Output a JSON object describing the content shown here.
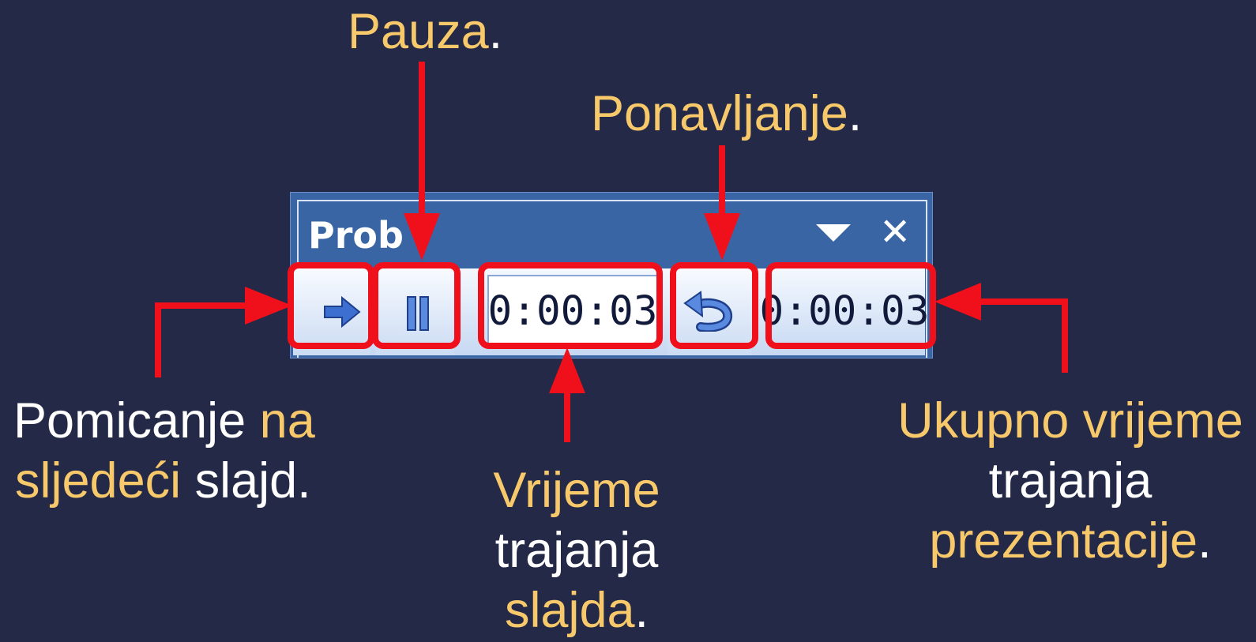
{
  "annotations": {
    "pause": {
      "main": "Pauza",
      "end": "."
    },
    "repeat": {
      "main": "Ponavljanje",
      "end": "."
    },
    "next": {
      "w1": "Pomicanje ",
      "y1": "na",
      "y2": "sljedeći",
      "w2": " slajd."
    },
    "slide_time": {
      "l1": "Vrijeme",
      "l2": "trajanja",
      "l3": "slajda",
      "end": "."
    },
    "total_time": {
      "l1": "Ukupno vrijeme",
      "l2": "trajanja",
      "l3": "prezentacije",
      "end": "."
    }
  },
  "toolbar": {
    "title": "Prob",
    "slide_time_value": "0:00:03",
    "total_time_value": "0:00:03"
  },
  "colors": {
    "background": "#232946",
    "highlight_text": "#f7c96b",
    "arrow": "#f0101c",
    "toolbar_title_bar": "#3a65a5"
  },
  "icons": [
    "dropdown-triangle-icon",
    "close-icon",
    "next-arrow-icon",
    "pause-icon",
    "repeat-icon"
  ]
}
